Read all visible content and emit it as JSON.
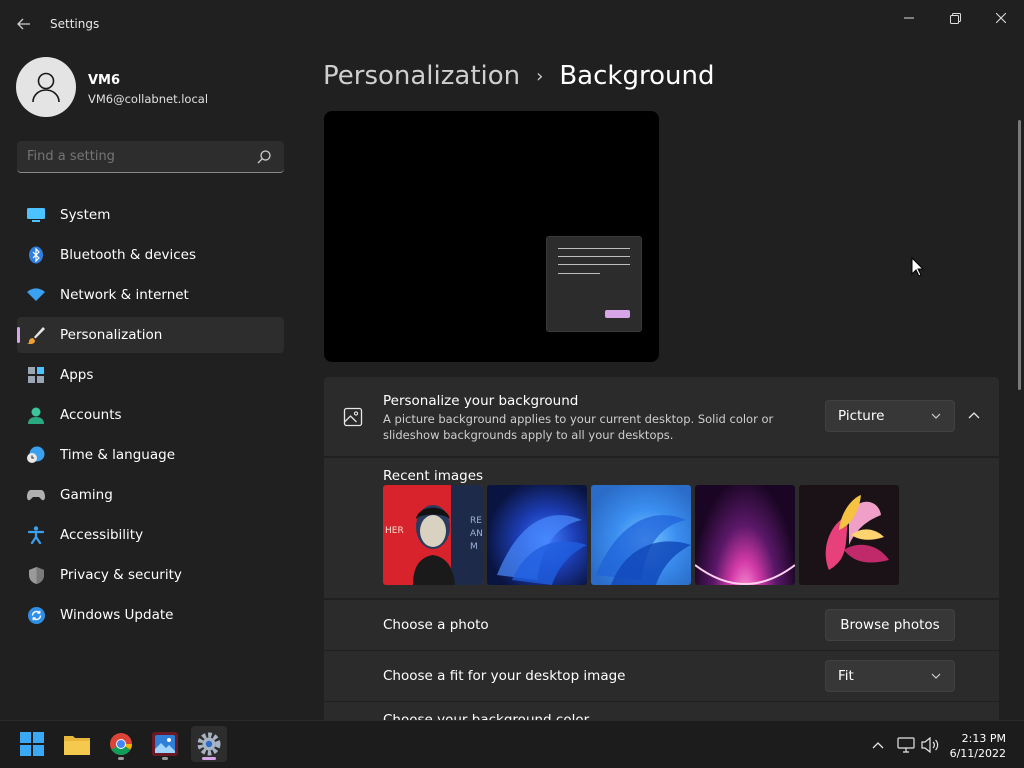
{
  "window": {
    "title": "Settings",
    "back_icon": "back-arrow-icon",
    "controls": [
      "minimize-icon",
      "restore-icon",
      "close-icon"
    ]
  },
  "profile": {
    "name": "VM6",
    "email": "VM6@collabnet.local"
  },
  "search": {
    "placeholder": "Find a setting"
  },
  "sidebar": {
    "items": [
      {
        "label": "System",
        "icon": "system-icon"
      },
      {
        "label": "Bluetooth & devices",
        "icon": "bluetooth-icon"
      },
      {
        "label": "Network & internet",
        "icon": "wifi-icon"
      },
      {
        "label": "Personalization",
        "icon": "brush-icon",
        "active": true
      },
      {
        "label": "Apps",
        "icon": "apps-icon"
      },
      {
        "label": "Accounts",
        "icon": "accounts-icon"
      },
      {
        "label": "Time & language",
        "icon": "globe-clock-icon"
      },
      {
        "label": "Gaming",
        "icon": "gamepad-icon"
      },
      {
        "label": "Accessibility",
        "icon": "accessibility-icon"
      },
      {
        "label": "Privacy & security",
        "icon": "shield-icon"
      },
      {
        "label": "Windows Update",
        "icon": "update-icon"
      }
    ]
  },
  "breadcrumb": {
    "parent": "Personalization",
    "separator": "›",
    "current": "Background"
  },
  "personalize": {
    "title": "Personalize your background",
    "description": "A picture background applies to your current desktop. Solid color or slideshow backgrounds apply to all your desktops.",
    "dropdown_value": "Picture"
  },
  "recent": {
    "label": "Recent images",
    "images": [
      "poster-portrait",
      "blue-bloom-dark",
      "blue-bloom-light",
      "purple-glow",
      "pink-flower"
    ],
    "poster_text_left": "HER",
    "poster_text_right": "RE\nAN\nM"
  },
  "choose_photo": {
    "label": "Choose a photo",
    "button": "Browse photos"
  },
  "fit": {
    "label": "Choose a fit for your desktop image",
    "value": "Fit"
  },
  "color_row": {
    "label": "Choose your background color"
  },
  "taskbar": {
    "apps": [
      "windows-start-icon",
      "file-explorer-icon",
      "chrome-icon",
      "photos-icon",
      "settings-icon"
    ],
    "time": "2:13 PM",
    "date": "6/11/2022"
  },
  "colors": {
    "accent": "#d8a6e8",
    "background": "#202020",
    "card": "#2b2b2b"
  }
}
